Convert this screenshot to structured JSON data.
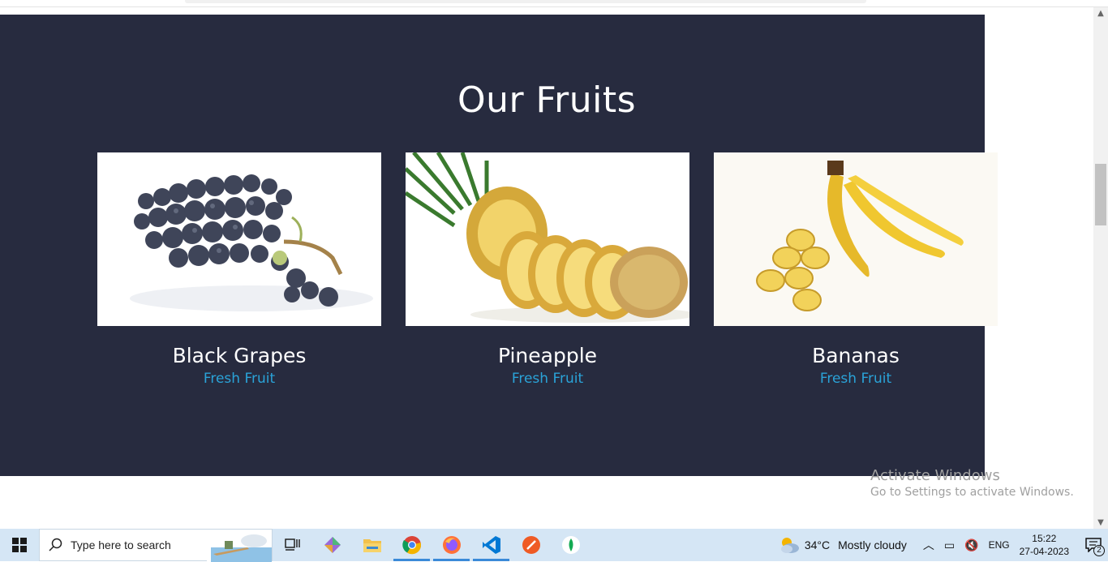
{
  "page": {
    "section_title": "Our Fruits",
    "fruits": [
      {
        "name": "Black Grapes",
        "subtitle": "Fresh Fruit",
        "image_icon": "grapes-image"
      },
      {
        "name": "Pineapple",
        "subtitle": "Fresh Fruit",
        "image_icon": "pineapple-image"
      },
      {
        "name": "Bananas",
        "subtitle": "Fresh Fruit",
        "image_icon": "bananas-image"
      }
    ]
  },
  "watermark": {
    "line1": "Activate Windows",
    "line2": "Go to Settings to activate Windows."
  },
  "taskbar": {
    "search_placeholder": "Type here to search",
    "apps": [
      "task-view-icon",
      "git-icon",
      "file-explorer-icon",
      "chrome-icon",
      "firefox-icon",
      "vscode-icon",
      "postman-icon",
      "mongodb-icon"
    ],
    "weather_temp": "34°C",
    "weather_text": "Mostly cloudy",
    "language": "ENG",
    "time": "15:22",
    "date": "27-04-2023",
    "notification_count": "2"
  },
  "colors": {
    "section_bg": "#272b3f",
    "accent": "#2aa3d8",
    "taskbar_bg": "#d5e6f5"
  }
}
